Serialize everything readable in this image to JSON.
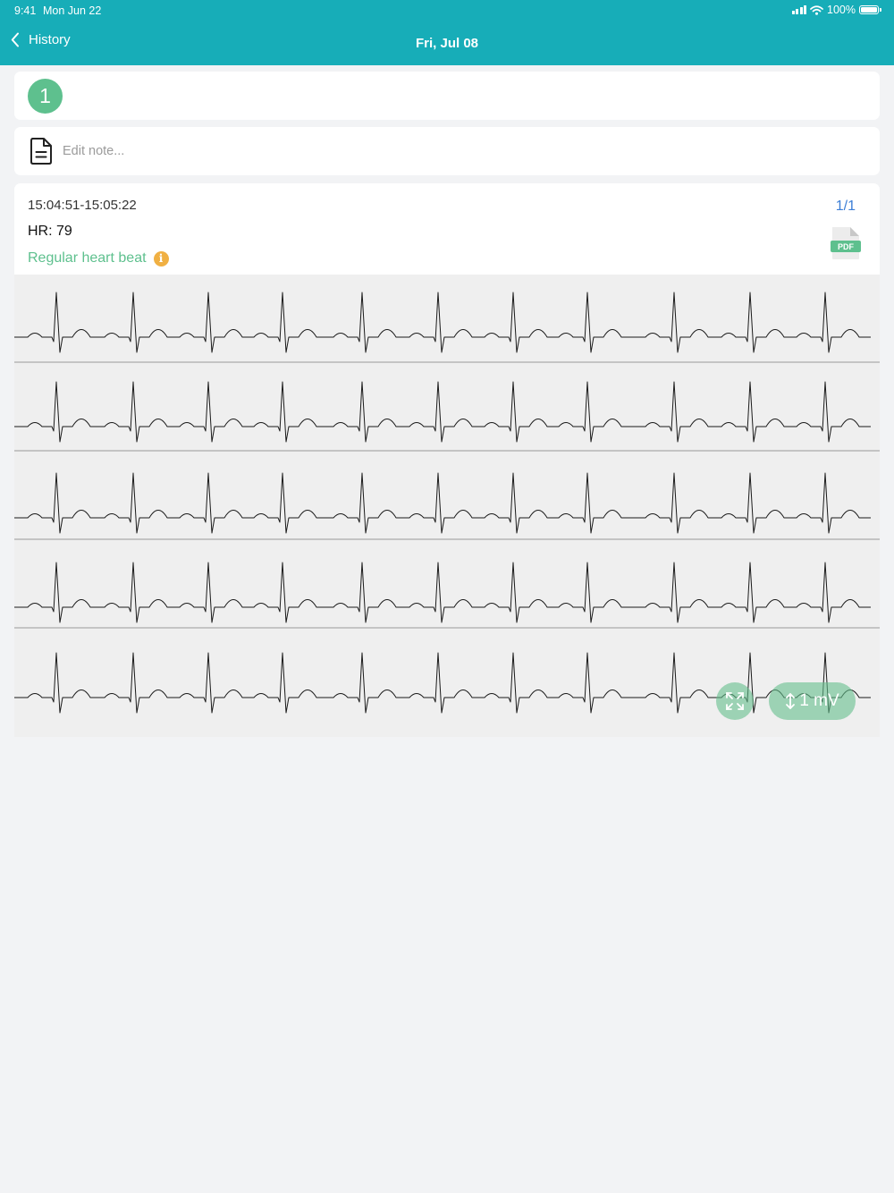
{
  "status_bar": {
    "time": "9:41",
    "date": "Mon Jun 22",
    "battery": "100%"
  },
  "nav": {
    "back_label": "History",
    "title": "Fri, Jul 08"
  },
  "record_count": "1",
  "note": {
    "placeholder": "Edit note..."
  },
  "record": {
    "time_range": "15:04:51-15:05:22",
    "hr": "HR: 79",
    "verdict": "Regular heart beat",
    "page_counter": "1/1",
    "pdf_label": "PDF"
  },
  "ecg": {
    "strip_count": 5,
    "beats_per_strip": 11,
    "heart_rate_bpm": 79
  },
  "controls": {
    "scale_label": "1 mV"
  },
  "colors": {
    "header": "#17adb8",
    "accent_green": "#5ec08e",
    "info_orange": "#f0b043",
    "link_blue": "#3d7fd6"
  }
}
